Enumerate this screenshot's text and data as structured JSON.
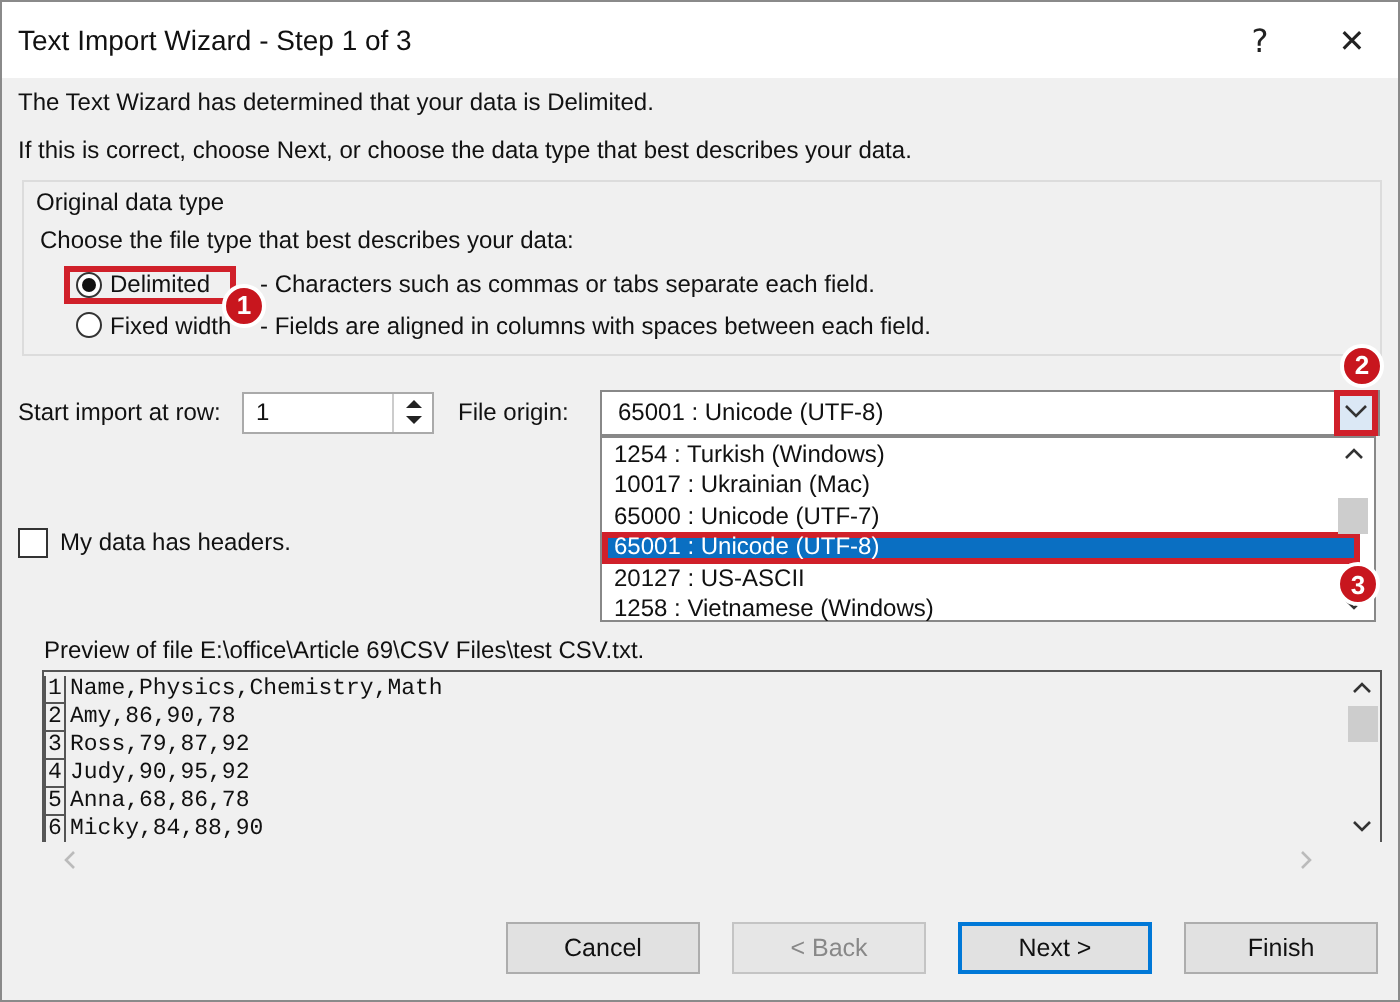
{
  "window": {
    "title": "Text Import Wizard - Step 1 of 3",
    "help": "?",
    "close": "✕"
  },
  "intro": [
    "The Text Wizard has determined that your data is Delimited.",
    "If this is correct, choose Next, or choose the data type that best describes your data."
  ],
  "data_type_group": {
    "title": "Original data type",
    "prompt": "Choose the file type that best describes your data:",
    "options": [
      {
        "label": "Delimited",
        "description": "- Characters such as commas or tabs separate each field.",
        "selected": true,
        "callout": "1"
      },
      {
        "label": "Fixed width",
        "description": "- Fields are aligned in columns with spaces between each field.",
        "selected": false
      }
    ]
  },
  "start_row": {
    "label": "Start import at row:",
    "value": "1"
  },
  "file_origin": {
    "label": "File origin:",
    "value": "65001 : Unicode (UTF-8)",
    "arrow_callout": "2",
    "options": [
      {
        "label": "1254 : Turkish (Windows)",
        "selected": false
      },
      {
        "label": "10017 : Ukrainian (Mac)",
        "selected": false
      },
      {
        "label": "65000 : Unicode (UTF-7)",
        "selected": false
      },
      {
        "label": "65001 : Unicode (UTF-8)",
        "selected": true,
        "callout": "3"
      },
      {
        "label": "20127 : US-ASCII",
        "selected": false
      },
      {
        "label": "1258 : Vietnamese (Windows)",
        "selected": false
      }
    ]
  },
  "headers_checkbox": {
    "label": "My data has headers.",
    "checked": false
  },
  "preview": {
    "label": "Preview of file E:\\office\\Article 69\\CSV Files\\test CSV.txt.",
    "lines": [
      {
        "number": "1",
        "text": "Name,Physics,Chemistry,Math"
      },
      {
        "number": "2",
        "text": "Amy,86,90,78"
      },
      {
        "number": "3",
        "text": "Ross,79,87,92"
      },
      {
        "number": "4",
        "text": "Judy,90,95,92"
      },
      {
        "number": "5",
        "text": "Anna,68,86,78"
      },
      {
        "number": "6",
        "text": "Micky,84,88,90"
      }
    ]
  },
  "buttons": [
    {
      "label": "Cancel",
      "disabled": false,
      "default": false
    },
    {
      "label": "< Back",
      "disabled": true,
      "default": false
    },
    {
      "label": "Next >",
      "disabled": false,
      "default": true
    },
    {
      "label": "Finish",
      "disabled": false,
      "default": false
    }
  ]
}
